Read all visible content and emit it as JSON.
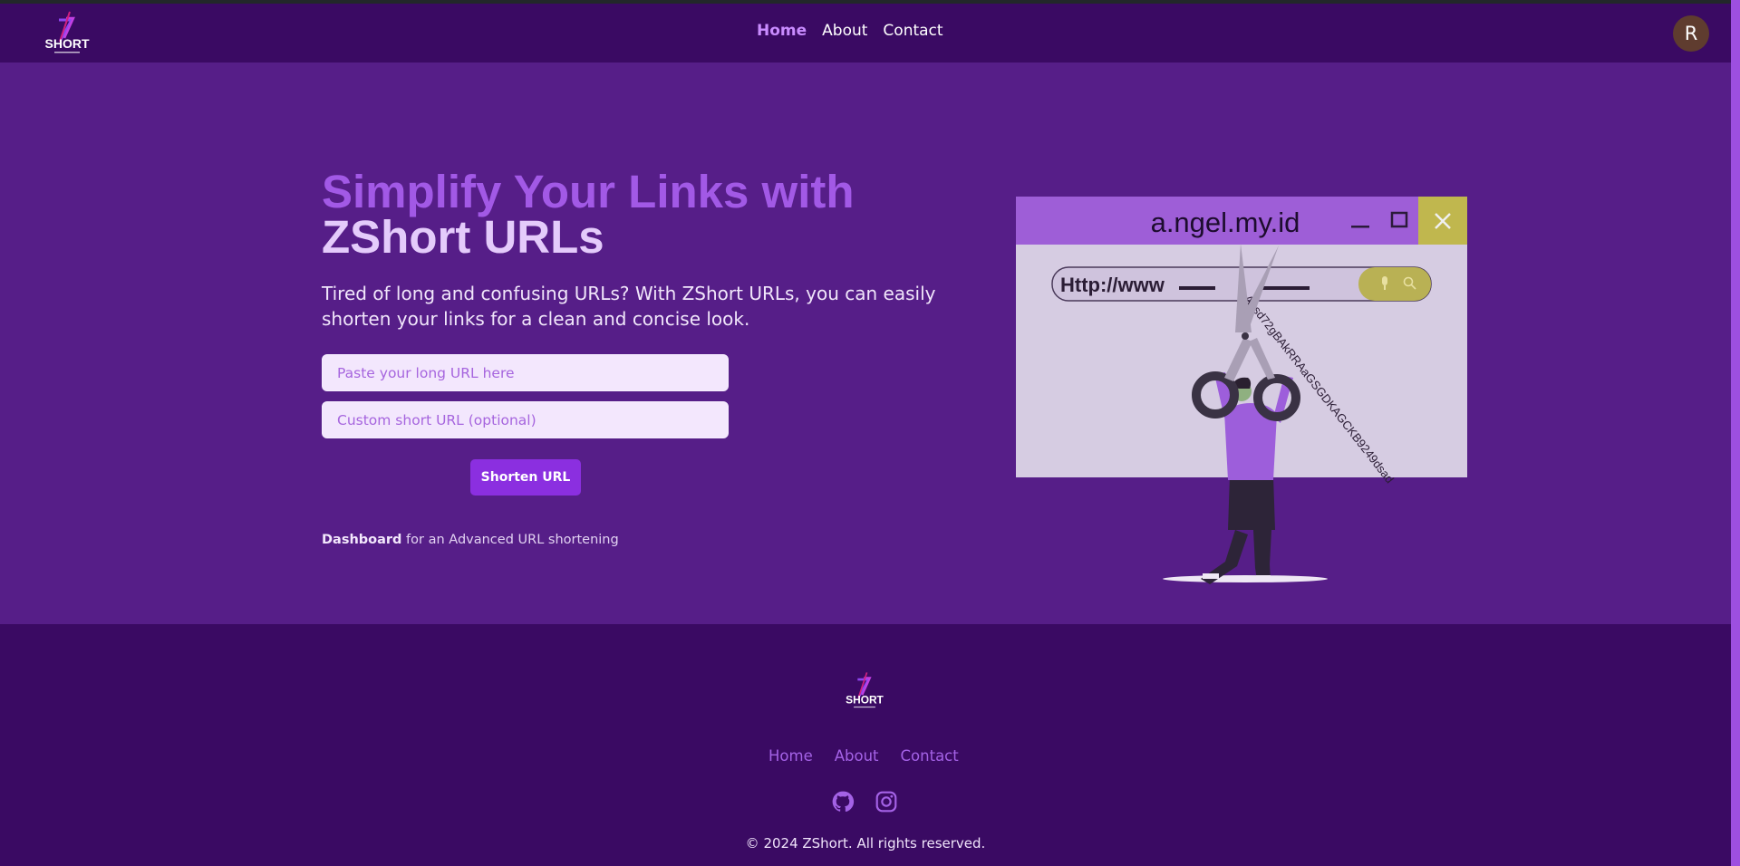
{
  "brand": {
    "name": "SHORT"
  },
  "nav": {
    "home": "Home",
    "about": "About",
    "contact": "Contact"
  },
  "user": {
    "avatar_initial": "R"
  },
  "hero": {
    "title_line1": "Simplify Your Links with",
    "title_line2": "ZShort URLs",
    "subtitle": "Tired of long and confusing URLs? With ZShort URLs, you can easily shorten your links for a clean and concise look.",
    "long_url_placeholder": "Paste your long URL here",
    "custom_url_placeholder": "Custom short URL (optional)",
    "shorten_button": "Shorten URL",
    "dashboard_link": "Dashboard",
    "dashboard_suffix": " for an Advanced URL shortening"
  },
  "illustration": {
    "window_title": "a.ngel.my.id",
    "address_text": "Http://www",
    "long_string": "Agsd72gBAkRRAaGSGDKAGCKB9249dsad"
  },
  "footer": {
    "links": [
      "Home",
      "About",
      "Contact"
    ],
    "icons": [
      "github-icon",
      "instagram-icon"
    ],
    "copyright": "© 2024 ZShort. All rights reserved."
  },
  "colors": {
    "header_bg": "#3a0a63",
    "hero_bg": "#561e88",
    "accent": "#a259e6",
    "button": "#8b2fe0"
  }
}
